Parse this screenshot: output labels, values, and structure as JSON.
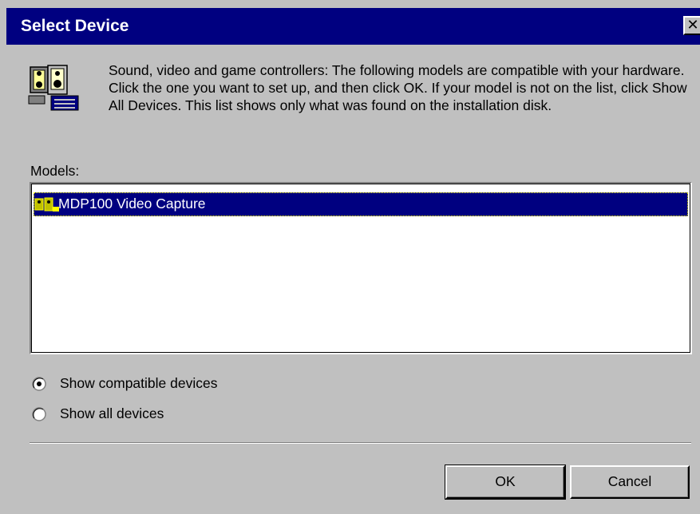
{
  "window": {
    "title": "Select Device",
    "close_glyph": "✕"
  },
  "icons": {
    "header_icon": "multimedia-device-icon",
    "list_item_icon": "video-capture-icon",
    "close": "close-icon"
  },
  "description": "Sound, video and game controllers: The following models are compatible with your hardware. Click the one you want to set up, and then click OK. If your model is not on the list, click Show All Devices. This list shows only what was found on the installation disk.",
  "models": {
    "label": "Models:",
    "items": [
      {
        "label": "MDP100 Video Capture",
        "selected": true
      }
    ]
  },
  "options": [
    {
      "label": "Show compatible devices",
      "checked": true
    },
    {
      "label": "Show all devices",
      "checked": false
    }
  ],
  "buttons": {
    "ok": "OK",
    "cancel": "Cancel"
  },
  "colors": {
    "title_bar": "#000080",
    "face": "#c0c0c0",
    "selection": "#000080"
  }
}
